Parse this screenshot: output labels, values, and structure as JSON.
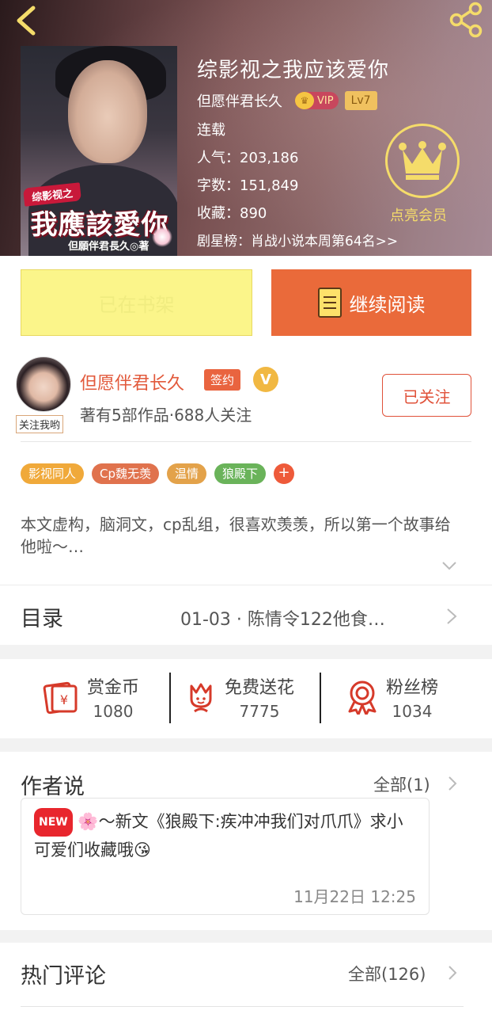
{
  "book": {
    "title": "综影视之我应该爱你",
    "author": "但愿伴君长久",
    "vip_label": "VIP",
    "level": "Lv7",
    "status": "连载",
    "popularity_label": "人气：",
    "popularity": "203,186",
    "words_label": "字数：",
    "words": "151,849",
    "collect_label": "收藏：",
    "collect": "890",
    "ranking": "剧星榜：肖战小说本周第64名>>",
    "member_label": "点亮会员",
    "cover": {
      "ribbon": "综影视之",
      "big_title": "我應該愛你",
      "byline": "但願伴君長久◎著"
    }
  },
  "actions": {
    "shelf_label": "已在书架",
    "read_label": "继续阅读"
  },
  "author_card": {
    "name": "但愿伴君长久",
    "signed_label": "签约",
    "v_label": "V",
    "stats": "著有5部作品·688人关注",
    "follow_tag": "关注我哟",
    "followed_label": "已关注"
  },
  "tags": [
    {
      "label": "影视同人",
      "color": "#f0a93a"
    },
    {
      "label": "Cp魏无羡",
      "color": "#e0724d"
    },
    {
      "label": "温情",
      "color": "#e3a24a"
    },
    {
      "label": "狼殿下",
      "color": "#6ab35a"
    }
  ],
  "tag_more": "+",
  "description": "本文虚构，脑洞文，cp乱组，很喜欢羡羡，所以第一个故事给他啦～…",
  "toc": {
    "title": "目录",
    "latest": "01-03 · 陈情令122他食…"
  },
  "support": [
    {
      "label": "赏金币",
      "value": "1080",
      "icon": "coin-envelope-icon"
    },
    {
      "label": "免费送花",
      "value": "7775",
      "icon": "flower-icon"
    },
    {
      "label": "粉丝榜",
      "value": "1034",
      "icon": "medal-icon"
    }
  ],
  "author_says": {
    "title": "作者说",
    "more": "全部(1)",
    "new_label": "NEW",
    "note": "🌸～新文《狼殿下:疾冲冲我们对爪爪》求小可爱们收藏哦😘",
    "time": "11月22日  12:25"
  },
  "hot_comments": {
    "title": "热门评论",
    "more": "全部(126)"
  },
  "colors": {
    "accent": "#ea6a3a",
    "author_name": "#e2593b",
    "gold": "#f5dc6a"
  }
}
